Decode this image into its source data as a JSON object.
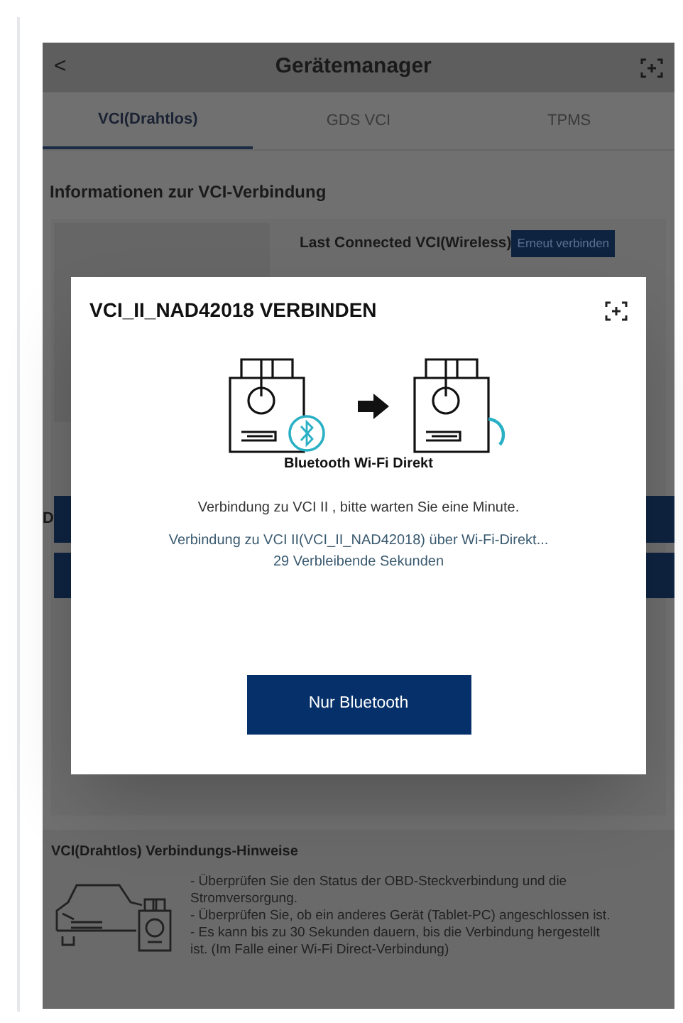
{
  "header": {
    "back": "<",
    "title": "Gerätemanager"
  },
  "tabs": [
    {
      "label": "VCI(Drahtlos)",
      "selected": true
    },
    {
      "label": "GDS VCI",
      "selected": false
    },
    {
      "label": "TPMS",
      "selected": false
    }
  ],
  "section_title": "Informationen zur VCI-Verbindung",
  "last_connected": {
    "label": "Last Connected VCI(Wireless)",
    "button": "Erneut verbinden"
  },
  "hidden_heading": "D",
  "hints": {
    "title": "VCI(Drahtlos) Verbindungs-Hinweise",
    "lines": [
      "- Überprüfen Sie den Status der OBD-Steckverbindung und die Stromversorgung.",
      "- Überprüfen Sie, ob ein anderes Gerät (Tablet-PC) angeschlossen ist.",
      "- Es kann bis zu 30 Sekunden dauern, bis die Verbindung hergestellt ist. (Im Falle einer Wi-Fi Direct-Verbindung)"
    ]
  },
  "dialog": {
    "title": "VCI_II_NAD42018 VERBINDEN",
    "illustration_caption": "Bluetooth Wi-Fi Direkt",
    "message": "Verbindung zu VCI II , bitte warten Sie eine Minute.",
    "progress": "Verbindung zu VCI II(VCI_II_NAD42018) über Wi-Fi-Direkt...",
    "countdown": "29 Verbleibende Sekunden",
    "button": "Nur Bluetooth"
  }
}
